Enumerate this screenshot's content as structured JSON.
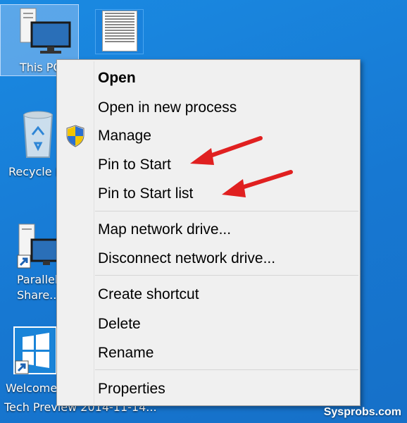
{
  "desktop": {
    "icons": [
      {
        "label": "This PC"
      },
      {
        "label": "Recycle Bin"
      },
      {
        "label": "Parallels",
        "label2": "Share..."
      },
      {
        "label": "Welcome",
        "label2": "Tech Preview  2014-11-14..."
      }
    ]
  },
  "context_menu": {
    "items": [
      {
        "label": "Open"
      },
      {
        "label": "Open in new process"
      },
      {
        "label": "Manage"
      },
      {
        "label": "Pin to Start"
      },
      {
        "label": "Pin to Start list"
      },
      {
        "label": "Map network drive..."
      },
      {
        "label": "Disconnect network drive..."
      },
      {
        "label": "Create shortcut"
      },
      {
        "label": "Delete"
      },
      {
        "label": "Rename"
      },
      {
        "label": "Properties"
      }
    ]
  },
  "watermark": "Sysprobs.com",
  "colors": {
    "desktop": "#1778d2",
    "menu_bg": "#f0f0f0",
    "arrow": "#e02020"
  }
}
